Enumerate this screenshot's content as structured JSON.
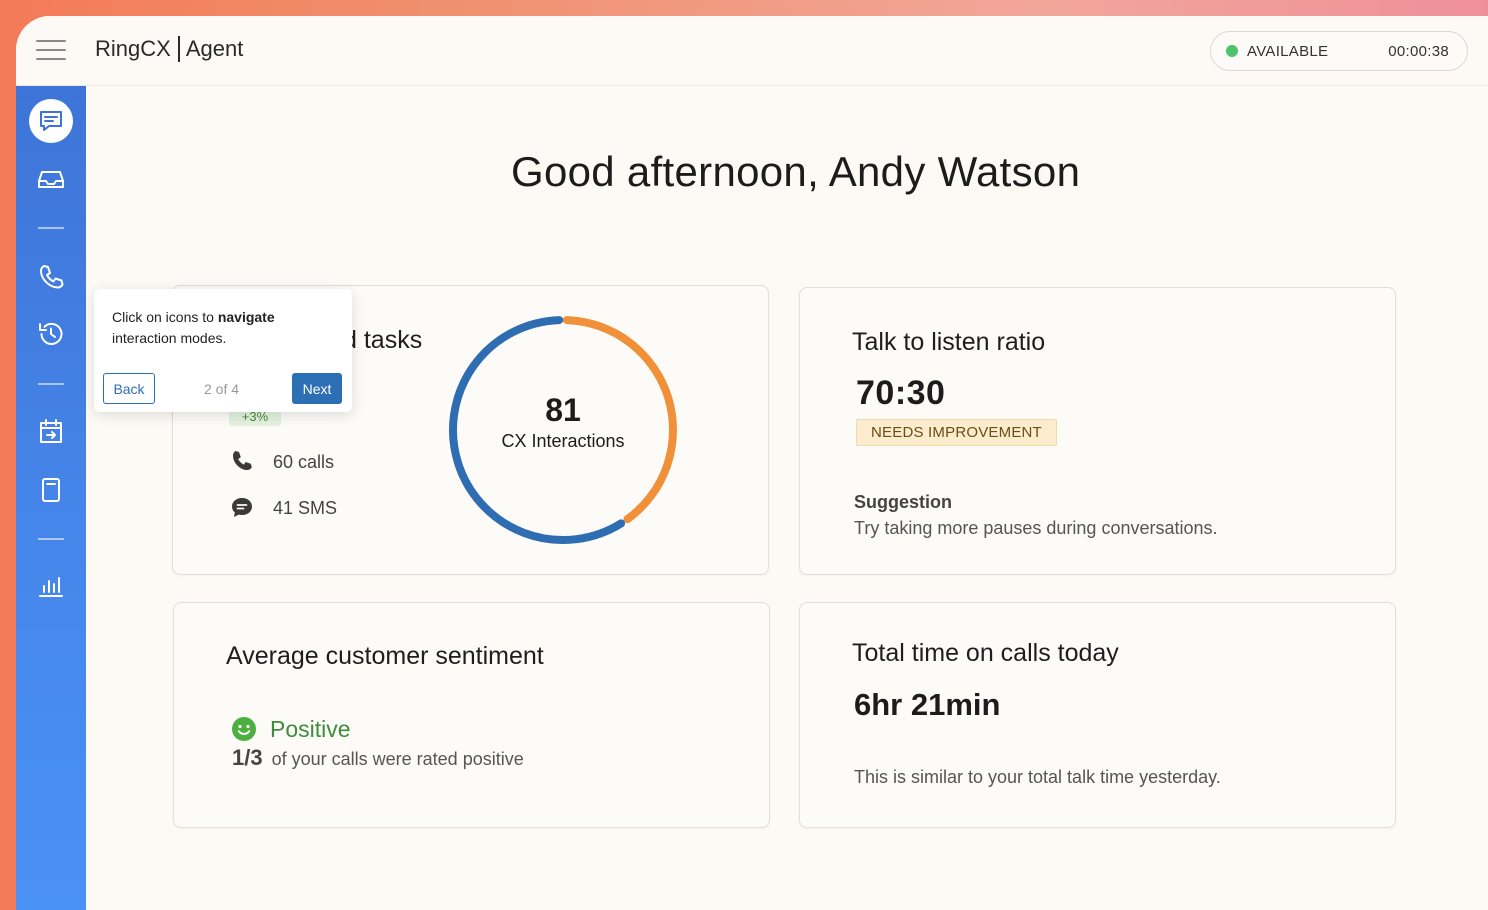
{
  "header": {
    "brand_name": "RingCX",
    "brand_product": "Agent",
    "status_label": "AVAILABLE",
    "status_timer": "00:00:38",
    "status_color": "#4cc46b"
  },
  "sidebar": {
    "items": [
      {
        "icon": "chat-icon",
        "active": true
      },
      {
        "icon": "inbox-icon"
      },
      {
        "icon": "phone-icon"
      },
      {
        "icon": "history-icon"
      },
      {
        "icon": "calendar-icon"
      },
      {
        "icon": "notes-icon"
      },
      {
        "icon": "analytics-icon"
      }
    ]
  },
  "greeting": "Good afternoon, Andy Watson",
  "tasks_card": {
    "title_visible": "d tasks",
    "change_badge": "+3%",
    "calls": "60 calls",
    "sms": "41 SMS",
    "donut_value": "81",
    "donut_label": "CX Interactions",
    "donut_segments": [
      {
        "name": "calls",
        "value": 60,
        "color": "#2f6db3"
      },
      {
        "name": "sms",
        "value": 41,
        "color": "#f0913a"
      }
    ]
  },
  "ratio_card": {
    "title": "Talk to listen ratio",
    "value": "70:30",
    "badge": "NEEDS IMPROVEMENT",
    "suggestion_heading": "Suggestion",
    "suggestion_text": "Try taking more pauses during conversations."
  },
  "sentiment_card": {
    "title": "Average customer sentiment",
    "sentiment": "Positive",
    "fraction": "1/3",
    "detail": "of your calls were rated positive"
  },
  "time_card": {
    "title": "Total time on calls today",
    "value": "6hr 21min",
    "detail": "This is similar to your total talk time yesterday."
  },
  "tooltip": {
    "text_prefix": "Click on icons to ",
    "text_bold": "navigate",
    "text_suffix": " interaction modes.",
    "back_label": "Back",
    "step_counter": "2 of 4",
    "next_label": "Next"
  }
}
